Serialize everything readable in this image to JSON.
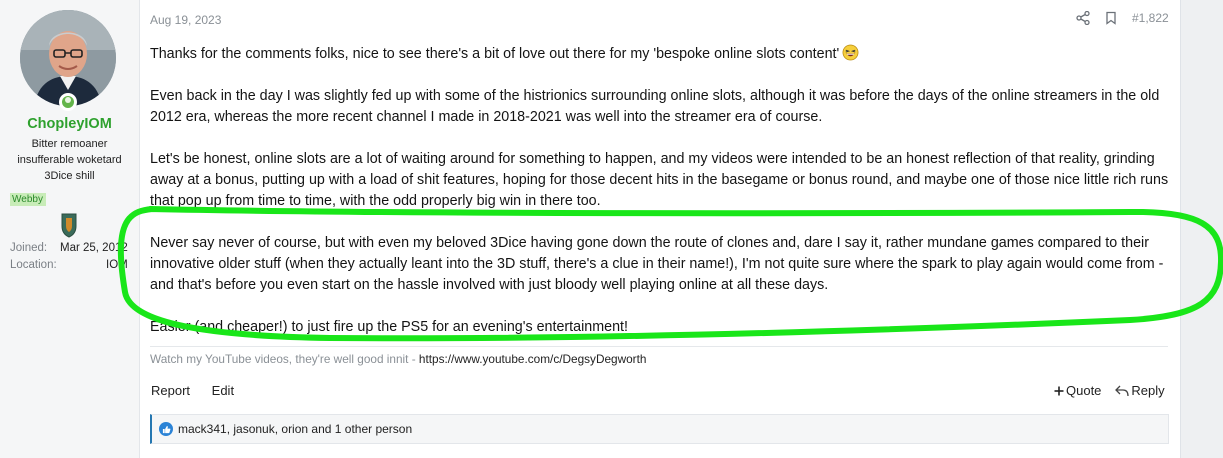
{
  "user": {
    "username": "ChopleyIOM",
    "title_lines": [
      "Bitter remoaner",
      "insufferable woketard",
      "3Dice shill"
    ],
    "banner": "Webby",
    "joined_label": "Joined:",
    "joined_value": "Mar 25, 2012",
    "location_label": "Location:",
    "location_value": "IOM"
  },
  "post": {
    "date": "Aug 19, 2023",
    "number": "#1,822",
    "paragraphs": [
      "Thanks for the comments folks, nice to see there's a bit of love out there for my 'bespoke online slots content'",
      "Even back in the day I was slightly fed up with some of the histrionics surrounding online slots, although it was before the days of the online streamers in the old 2012 era, whereas the more recent channel I made in 2018-2021 was well into the streamer era of course.",
      "Let's be honest, online slots are a lot of waiting around for something to happen, and my videos were intended to be an honest reflection of that reality, grinding away at a bonus, putting up with a load of shit features, hoping for those decent hits in the basegame or bonus round, and maybe one of those nice little rich runs that pop up from time to time, with the odd properly big win in there too.",
      "Never say never of course, but with even my beloved 3Dice having gone down the route of clones and, dare I say it, rather mundane games compared to their innovative older stuff (when they actually leant into the 3D stuff, there's a clue in their name!), I'm not quite sure where the spark to play again would come from - and that's before you even start on the hassle involved with just bloody well playing online at all these days.",
      "Easier (and cheaper!) to just fire up the PS5 for an evening's entertainment!"
    ],
    "signature_text": "Watch my YouTube videos, they're well good innit - ",
    "signature_link": "https://www.youtube.com/c/DegsyDegworth"
  },
  "footer": {
    "report": "Report",
    "edit": "Edit",
    "quote": "Quote",
    "reply": "Reply"
  },
  "reactions": {
    "text": "mack341, jasonuk, orion and 1 other person"
  },
  "icons": {
    "share": "share-icon",
    "bookmark": "bookmark-icon",
    "emoji": "laughing-emoji-icon",
    "like": "thumbs-up-icon",
    "quote": "plus-icon",
    "reply": "reply-arrow-icon"
  },
  "colors": {
    "username": "#2ea12e",
    "highlight": "#19e619",
    "like": "#2b83d6"
  }
}
